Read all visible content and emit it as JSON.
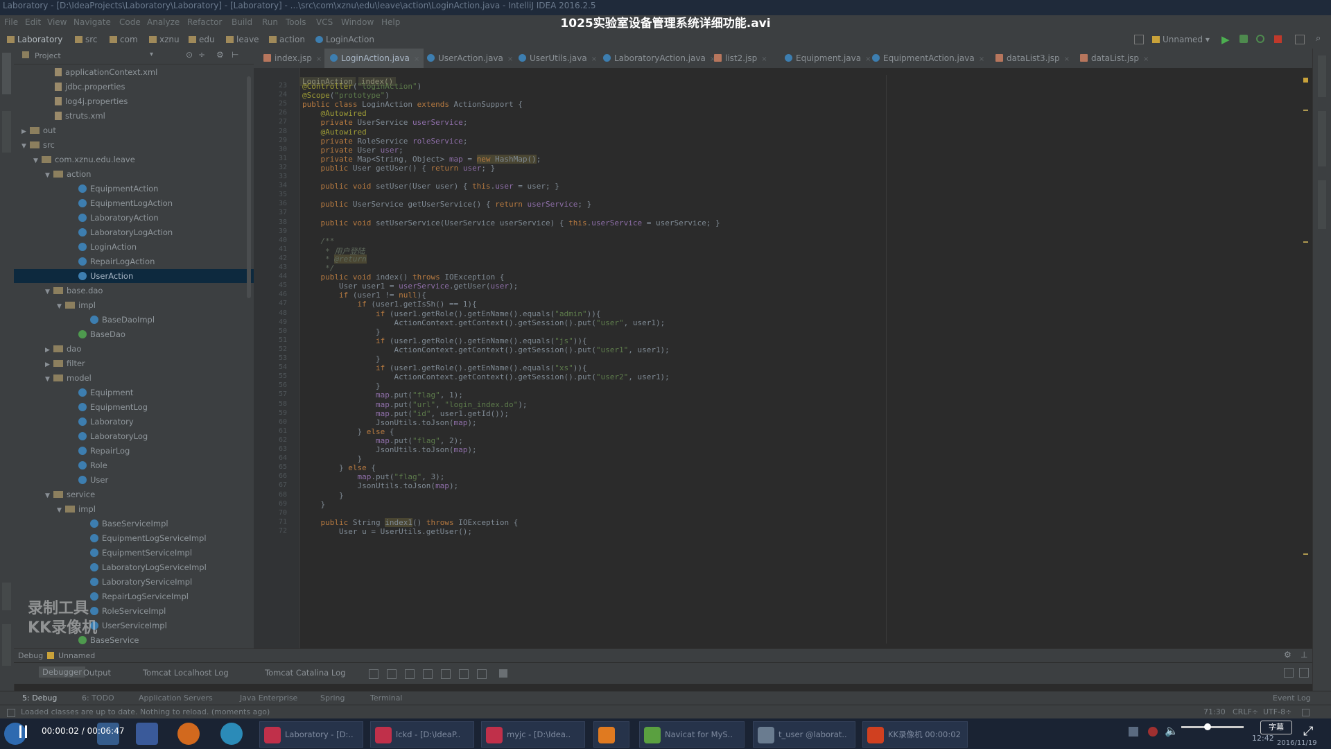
{
  "window_title": "Laboratory - [D:\\IdeaProjects\\Laboratory\\Laboratory] - [Laboratory] - ...\\src\\com\\xznu\\edu\\leave\\action\\LoginAction.java - IntelliJ IDEA 2016.2.5",
  "video_title": "1025实验室设备管理系统详细功能.avi",
  "menu": [
    "File",
    "Edit",
    "View",
    "Navigate",
    "Code",
    "Analyze",
    "Refactor",
    "Build",
    "Run",
    "Tools",
    "VCS",
    "Window",
    "Help"
  ],
  "breadcrumbs": [
    "Laboratory",
    "src",
    "com",
    "xznu",
    "edu",
    "leave",
    "action",
    "LoginAction"
  ],
  "run_config": "Unnamed",
  "project_panel": {
    "title": "Project",
    "items": [
      {
        "label": "applicationContext.xml",
        "indent": 3,
        "kind": "file"
      },
      {
        "label": "jdbc.properties",
        "indent": 3,
        "kind": "file"
      },
      {
        "label": "log4j.properties",
        "indent": 3,
        "kind": "file"
      },
      {
        "label": "struts.xml",
        "indent": 3,
        "kind": "file"
      },
      {
        "label": "out",
        "indent": 1,
        "kind": "folder",
        "arrow": "▶"
      },
      {
        "label": "src",
        "indent": 1,
        "kind": "folder",
        "arrow": "▼"
      },
      {
        "label": "com.xznu.edu.leave",
        "indent": 2,
        "kind": "folder",
        "arrow": "▼"
      },
      {
        "label": "action",
        "indent": 3,
        "kind": "folder",
        "arrow": "▼"
      },
      {
        "label": "EquipmentAction",
        "indent": 5,
        "kind": "class"
      },
      {
        "label": "EquipmentLogAction",
        "indent": 5,
        "kind": "class"
      },
      {
        "label": "LaboratoryAction",
        "indent": 5,
        "kind": "class"
      },
      {
        "label": "LaboratoryLogAction",
        "indent": 5,
        "kind": "class"
      },
      {
        "label": "LoginAction",
        "indent": 5,
        "kind": "class"
      },
      {
        "label": "RepairLogAction",
        "indent": 5,
        "kind": "class"
      },
      {
        "label": "UserAction",
        "indent": 5,
        "kind": "class",
        "selected": true
      },
      {
        "label": "base.dao",
        "indent": 3,
        "kind": "folder",
        "arrow": "▼"
      },
      {
        "label": "impl",
        "indent": 4,
        "kind": "folder",
        "arrow": "▼"
      },
      {
        "label": "BaseDaoImpl",
        "indent": 6,
        "kind": "class"
      },
      {
        "label": "BaseDao",
        "indent": 5,
        "kind": "iface"
      },
      {
        "label": "dao",
        "indent": 3,
        "kind": "folder",
        "arrow": "▶"
      },
      {
        "label": "filter",
        "indent": 3,
        "kind": "folder",
        "arrow": "▶"
      },
      {
        "label": "model",
        "indent": 3,
        "kind": "folder",
        "arrow": "▼"
      },
      {
        "label": "Equipment",
        "indent": 5,
        "kind": "class"
      },
      {
        "label": "EquipmentLog",
        "indent": 5,
        "kind": "class"
      },
      {
        "label": "Laboratory",
        "indent": 5,
        "kind": "class"
      },
      {
        "label": "LaboratoryLog",
        "indent": 5,
        "kind": "class"
      },
      {
        "label": "RepairLog",
        "indent": 5,
        "kind": "class"
      },
      {
        "label": "Role",
        "indent": 5,
        "kind": "class"
      },
      {
        "label": "User",
        "indent": 5,
        "kind": "class"
      },
      {
        "label": "service",
        "indent": 3,
        "kind": "folder",
        "arrow": "▼"
      },
      {
        "label": "impl",
        "indent": 4,
        "kind": "folder",
        "arrow": "▼"
      },
      {
        "label": "BaseServiceImpl",
        "indent": 6,
        "kind": "class"
      },
      {
        "label": "EquipmentLogServiceImpl",
        "indent": 6,
        "kind": "class"
      },
      {
        "label": "EquipmentServiceImpl",
        "indent": 6,
        "kind": "class"
      },
      {
        "label": "LaboratoryLogServiceImpl",
        "indent": 6,
        "kind": "class"
      },
      {
        "label": "LaboratoryServiceImpl",
        "indent": 6,
        "kind": "class"
      },
      {
        "label": "RepairLogServiceImpl",
        "indent": 6,
        "kind": "class"
      },
      {
        "label": "RoleServiceImpl",
        "indent": 6,
        "kind": "class"
      },
      {
        "label": "UserServiceImpl",
        "indent": 6,
        "kind": "class"
      },
      {
        "label": "BaseService",
        "indent": 5,
        "kind": "iface"
      }
    ]
  },
  "editor_tabs": [
    {
      "label": "index.jsp",
      "type": "jsp"
    },
    {
      "label": "LoginAction.java",
      "type": "java",
      "active": true
    },
    {
      "label": "UserAction.java",
      "type": "java"
    },
    {
      "label": "UserUtils.java",
      "type": "java"
    },
    {
      "label": "LaboratoryAction.java",
      "type": "java"
    },
    {
      "label": "list2.jsp",
      "type": "jsp"
    },
    {
      "label": "Equipment.java",
      "type": "java"
    },
    {
      "label": "EquipmentAction.java",
      "type": "java"
    },
    {
      "label": "dataList3.jsp",
      "type": "jsp"
    },
    {
      "label": "dataList.jsp",
      "type": "jsp"
    }
  ],
  "editor_crumbs": [
    "LoginAction",
    "index()"
  ],
  "code_lines": [
    {
      "html": "<span class='ann'>@Controller</span>(<span class='str'>\"loginAction\"</span>)"
    },
    {
      "html": "<span class='ann'>@Scope</span>(<span class='str'>\"prototype\"</span>)"
    },
    {
      "html": "<span class='kw'>public class</span> LoginAction <span class='kw'>extends</span> ActionSupport {"
    },
    {
      "html": "    <span class='ann'>@Autowired</span>"
    },
    {
      "html": "    <span class='kw'>private</span> UserService <span class='fld'>userService</span>;"
    },
    {
      "html": "    <span class='ann'>@Autowired</span>"
    },
    {
      "html": "    <span class='kw'>private</span> RoleService <span class='fld'>roleService</span>;"
    },
    {
      "html": "    <span class='kw'>private</span> User <span class='fld'>user</span>;"
    },
    {
      "html": "    <span class='kw'>private</span> Map&lt;String, Object&gt; <span class='fld'>map</span> = <span class='hl'><span class='kw'>new</span> HashMap()</span>;"
    },
    {
      "html": "    <span class='kw'>public</span> User getUser() { <span class='kw'>return</span> <span class='fld'>user</span>; }"
    },
    {
      "html": ""
    },
    {
      "html": "    <span class='kw'>public void</span> setUser(User user) { <span class='kw'>this</span>.<span class='fld'>user</span> = user; }"
    },
    {
      "html": ""
    },
    {
      "html": "    <span class='kw'>public</span> UserService getUserService() { <span class='kw'>return</span> <span class='fld'>userService</span>; }"
    },
    {
      "html": ""
    },
    {
      "html": "    <span class='kw'>public void</span> setUserService(UserService userService) { <span class='kw'>this</span>.<span class='fld'>userService</span> = userService; }"
    },
    {
      "html": ""
    },
    {
      "html": "    <span class='cmt'>/**</span>"
    },
    {
      "html": "    <span class='cmt'> * 用户登陆</span>"
    },
    {
      "html": "    <span class='cmt'> * <span class='hl'>@return</span></span>"
    },
    {
      "html": "    <span class='cmt'> */</span>"
    },
    {
      "html": "    <span class='kw'>public void</span> index() <span class='kw'>throws</span> IOException {"
    },
    {
      "html": "        User user1 = <span class='fld'>userService</span>.getUser(<span class='fld'>user</span>);"
    },
    {
      "html": "        <span class='kw'>if</span> (user1 != <span class='kw'>null</span>){"
    },
    {
      "html": "            <span class='kw'>if</span> (user1.getIsSh() == 1){"
    },
    {
      "html": "                <span class='kw'>if</span> (user1.getRole().getEnName().equals(<span class='str'>\"admin\"</span>)){"
    },
    {
      "html": "                    ActionContext.getContext().getSession().put(<span class='str'>\"user\"</span>, user1);"
    },
    {
      "html": "                }"
    },
    {
      "html": "                <span class='kw'>if</span> (user1.getRole().getEnName().equals(<span class='str'>\"js\"</span>)){"
    },
    {
      "html": "                    ActionContext.getContext().getSession().put(<span class='str'>\"user1\"</span>, user1);"
    },
    {
      "html": "                }"
    },
    {
      "html": "                <span class='kw'>if</span> (user1.getRole().getEnName().equals(<span class='str'>\"xs\"</span>)){"
    },
    {
      "html": "                    ActionContext.getContext().getSession().put(<span class='str'>\"user2\"</span>, user1);"
    },
    {
      "html": "                }"
    },
    {
      "html": "                <span class='fld'>map</span>.put(<span class='str'>\"flag\"</span>, 1);"
    },
    {
      "html": "                <span class='fld'>map</span>.put(<span class='str'>\"url\"</span>, <span class='str'>\"login_index.do\"</span>);"
    },
    {
      "html": "                <span class='fld'>map</span>.put(<span class='str'>\"id\"</span>, user1.getId());"
    },
    {
      "html": "                JsonUtils.toJson(<span class='fld'>map</span>);"
    },
    {
      "html": "            } <span class='kw'>else</span> {"
    },
    {
      "html": "                <span class='fld'>map</span>.put(<span class='str'>\"flag\"</span>, 2);"
    },
    {
      "html": "                JsonUtils.toJson(<span class='fld'>map</span>);"
    },
    {
      "html": "            }"
    },
    {
      "html": "        } <span class='kw'>else</span> {"
    },
    {
      "html": "            <span class='fld'>map</span>.put(<span class='str'>\"flag\"</span>, 3);"
    },
    {
      "html": "            JsonUtils.toJson(<span class='fld'>map</span>);"
    },
    {
      "html": "        }"
    },
    {
      "html": "    }"
    },
    {
      "html": ""
    },
    {
      "html": "    <span class='kw'>public</span> String <span class='hl'>index1</span>() <span class='kw'>throws</span> IOException {"
    },
    {
      "html": "        User u = UserUtils.getUser();"
    }
  ],
  "bottom_panel": {
    "title": "Debug",
    "config": "Unnamed",
    "tabs": [
      "Debugger",
      "Output",
      "Tomcat Localhost Log",
      "Tomcat Catalina Log"
    ]
  },
  "tool_tabs": [
    "5: Debug",
    "6: TODO",
    "Application Servers",
    "Java Enterprise",
    "Spring",
    "Terminal",
    "Event Log"
  ],
  "status": {
    "message": "Loaded classes are up to date. Nothing to reload. (moments ago)",
    "position": "71:30",
    "line_sep": "CRLF÷",
    "encoding": "UTF-8÷"
  },
  "watermark": [
    "录制工具",
    "KK录像机"
  ],
  "player": {
    "time": "00:00:02 / 00:06:47",
    "subtitle_label": "字幕"
  },
  "taskbar": [
    {
      "label": "Laboratory - [D:..",
      "color": "#c0304a"
    },
    {
      "label": "lckd - [D:\\IdeaP..",
      "color": "#c0304a"
    },
    {
      "label": "myjc - [D:\\Idea..",
      "color": "#c0304a"
    },
    {
      "label": "",
      "color": "#e07a20"
    },
    {
      "label": "Navicat for MyS..",
      "color": "#5aa040"
    },
    {
      "label": "t_user @laborat..",
      "color": "#6a7c90"
    },
    {
      "label": "KK录像机 00:00:02",
      "color": "#d04020"
    }
  ],
  "clock": {
    "time": "12:42",
    "date": "2016/11/19"
  }
}
